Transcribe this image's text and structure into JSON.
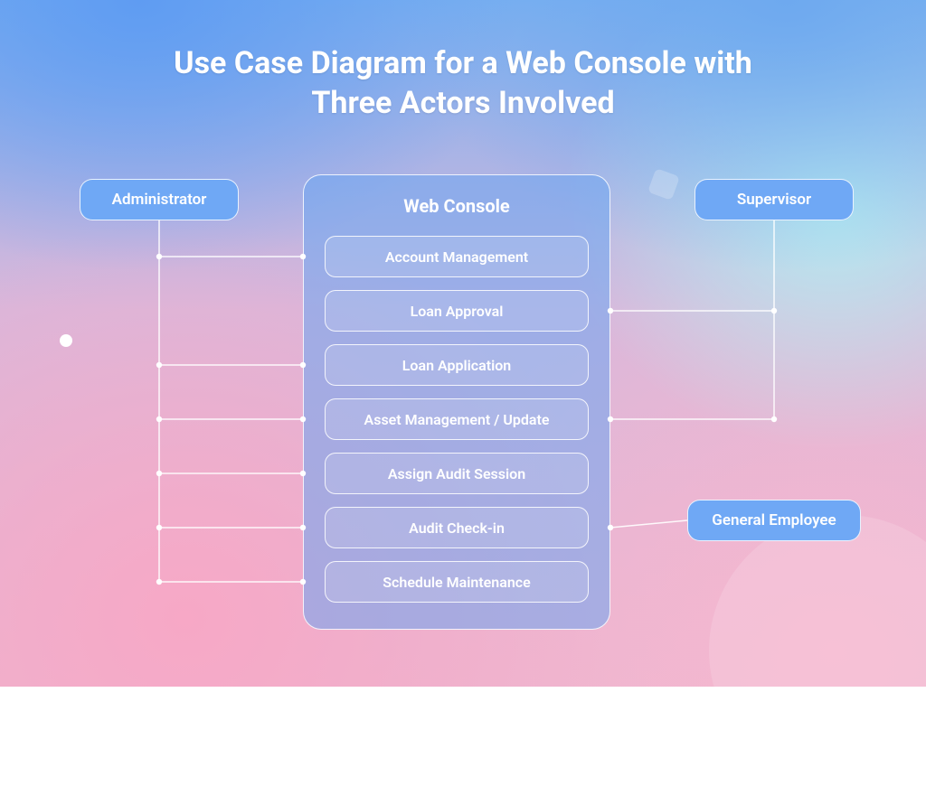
{
  "title_line1": "Use Case Diagram for a Web Console with",
  "title_line2": "Three Actors Involved",
  "system_title": "Web Console",
  "actors": {
    "admin": "Administrator",
    "supervisor": "Supervisor",
    "employee": "General Employee"
  },
  "usecases": {
    "uc1": "Account Management",
    "uc2": "Loan Approval",
    "uc3": "Loan Application",
    "uc4": "Asset Management / Update",
    "uc5": "Assign Audit Session",
    "uc6": "Audit Check-in",
    "uc7": "Schedule Maintenance"
  },
  "connections": {
    "admin": [
      "uc1",
      "uc3",
      "uc4",
      "uc5",
      "uc6",
      "uc7"
    ],
    "supervisor": [
      "uc2",
      "uc4"
    ],
    "employee": [
      "uc6"
    ]
  }
}
